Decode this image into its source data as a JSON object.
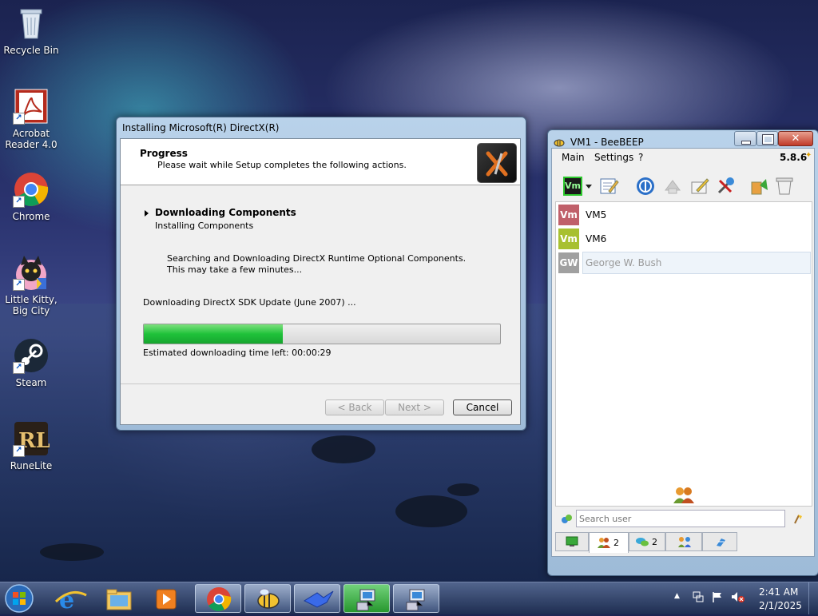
{
  "desktop": {
    "icons": [
      {
        "label": "Recycle Bin"
      },
      {
        "label": "Acrobat Reader 4.0"
      },
      {
        "label": "Chrome"
      },
      {
        "label": "Little Kitty, Big City"
      },
      {
        "label": "Steam"
      },
      {
        "label": "RuneLite"
      }
    ]
  },
  "installer": {
    "title": "Installing Microsoft(R) DirectX(R)",
    "header_title": "Progress",
    "header_subtitle": "Please wait while Setup completes the following actions.",
    "step_current": "Downloading Components",
    "step_next": "Installing Components",
    "info_line1": "Searching and Downloading DirectX Runtime Optional Components.",
    "info_line2": "This may take a few minutes...",
    "status": "Downloading DirectX SDK Update (June 2007) ...",
    "progress_fraction": 0.39,
    "eta": "Estimated downloading time left: 00:00:29",
    "back_label": "< Back",
    "next_label": "Next >",
    "cancel_label": "Cancel"
  },
  "beebeep": {
    "title": "VM1 - BeeBEEP",
    "menu": [
      "Main",
      "Settings",
      "?"
    ],
    "version": "5.8.6",
    "users": [
      {
        "initials": "Vm",
        "name": "VM5",
        "color": "#c0606a"
      },
      {
        "initials": "Vm",
        "name": "VM6",
        "color": "#a8c030"
      },
      {
        "initials": "GW",
        "name": "George W. Bush",
        "color": "#a0a0a0"
      }
    ],
    "search_placeholder": "Search user",
    "tabs": [
      {
        "icon": "monitor-icon",
        "count": ""
      },
      {
        "icon": "users-icon",
        "count": "2"
      },
      {
        "icon": "chat-icon",
        "count": "2"
      },
      {
        "icon": "groups-icon",
        "count": ""
      },
      {
        "icon": "share-icon",
        "count": ""
      }
    ]
  },
  "taskbar": {
    "time": "2:41 AM",
    "date": "2/1/2025",
    "apps": [
      "start-orb",
      "internet-explorer",
      "file-explorer",
      "media-player",
      "chrome",
      "beebeep",
      "bird-app",
      "network-app-1",
      "network-app-2"
    ]
  },
  "colors": {
    "progress_green": "#1fc23a",
    "win_border": "#4d6a8a"
  }
}
